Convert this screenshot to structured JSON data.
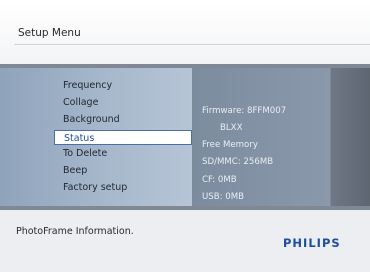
{
  "header": {
    "title": "Setup Menu"
  },
  "menu": {
    "items": [
      "Frequency",
      "Collage",
      "Background",
      "Status",
      "To Delete",
      "Beep",
      "Factory setup"
    ],
    "selected": "Status"
  },
  "info": {
    "lines": [
      "Firmware: 8FFM007",
      "BLXX",
      "Free Memory",
      "SD/MMC: 256MB",
      "CF: 0MB",
      "USB: 0MB"
    ]
  },
  "footer": {
    "description": "PhotoFrame Information.",
    "brand": "PHILIPS"
  },
  "colors": {
    "accent": "#1d4ea0",
    "selection_border": "#4a6ea6"
  }
}
